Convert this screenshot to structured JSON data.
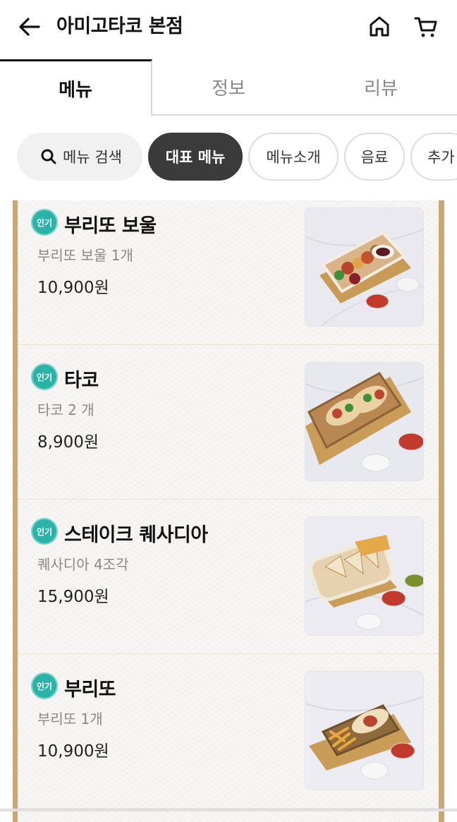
{
  "header": {
    "store_title": "아미고타코 본점",
    "back_icon": "arrow-left-icon",
    "home_icon": "home-icon",
    "cart_icon": "cart-icon"
  },
  "tabs": [
    {
      "label": "메뉴",
      "active": true
    },
    {
      "label": "정보",
      "active": false
    },
    {
      "label": "리뷰",
      "active": false
    }
  ],
  "chips": {
    "search_label": "메뉴 검색",
    "items": [
      {
        "label": "대표 메뉴",
        "active": true
      },
      {
        "label": "메뉴소개",
        "active": false
      },
      {
        "label": "음료",
        "active": false
      },
      {
        "label": "추가",
        "active": false
      }
    ]
  },
  "menu": {
    "badge_label": "인기",
    "items": [
      {
        "name": "부리또 보울",
        "desc": "부리또 보울 1개",
        "price": "10,900원",
        "photo": "burrito-bowl"
      },
      {
        "name": "타코",
        "desc": "타코 2 개",
        "price": "8,900원",
        "photo": "tacos"
      },
      {
        "name": "스테이크 퀘사디아",
        "desc": "퀘사디아 4조각",
        "price": "15,900원",
        "photo": "quesadilla"
      },
      {
        "name": "부리또",
        "desc": "부리또 1개",
        "price": "10,900원",
        "photo": "burrito"
      }
    ]
  },
  "colors": {
    "accent_dark": "#3b3b3b",
    "badge": "#2bb3a7",
    "frame": "#c9a778"
  }
}
